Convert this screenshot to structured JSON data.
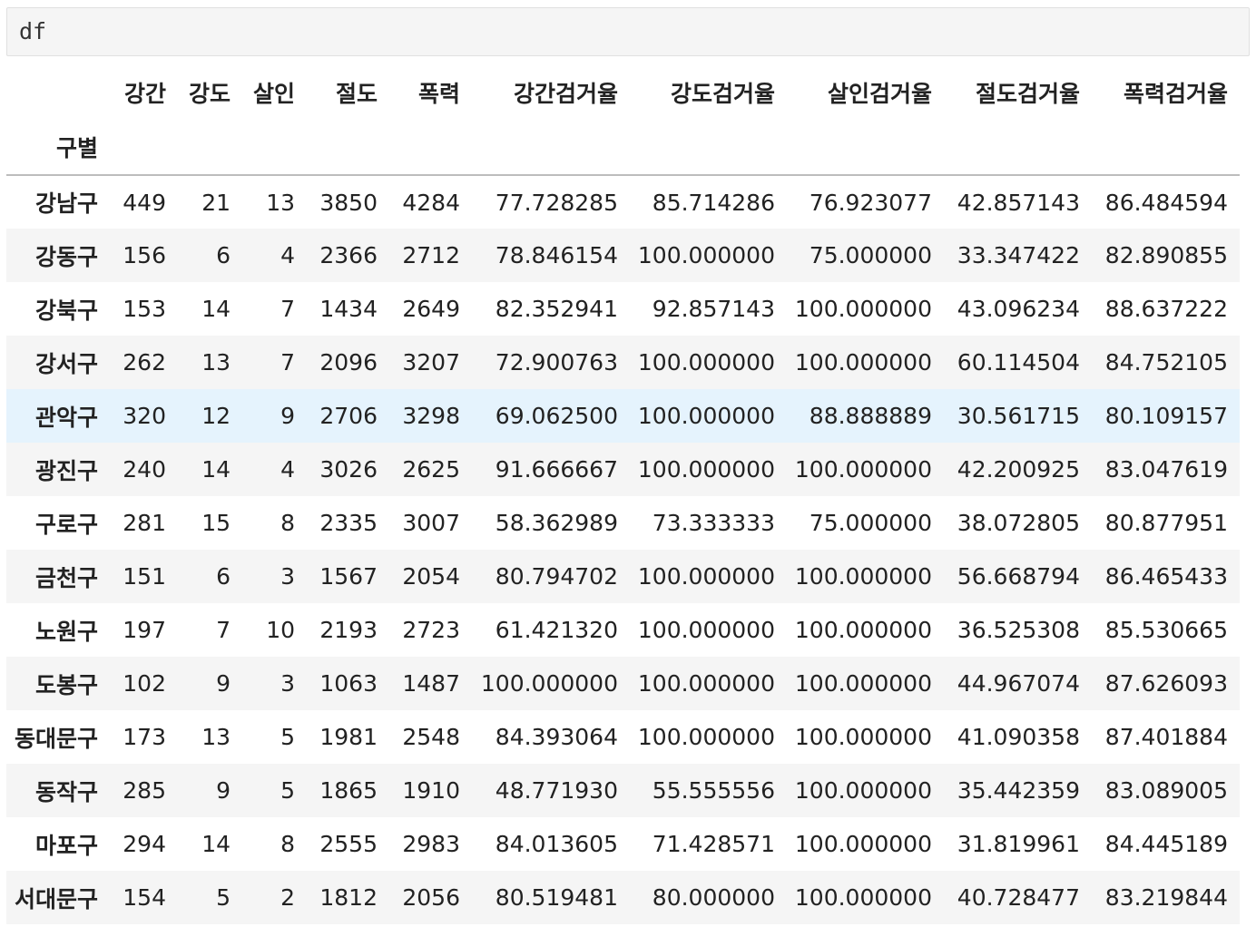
{
  "input_cell": {
    "code": "df"
  },
  "dataframe": {
    "index_name": "구별",
    "columns": [
      "강간",
      "강도",
      "살인",
      "절도",
      "폭력",
      "강간검거율",
      "강도검거율",
      "살인검거율",
      "절도검거율",
      "폭력검거율"
    ],
    "rows": [
      {
        "index": "강남구",
        "values": [
          "449",
          "21",
          "13",
          "3850",
          "4284",
          "77.728285",
          "85.714286",
          "76.923077",
          "42.857143",
          "86.484594"
        ]
      },
      {
        "index": "강동구",
        "values": [
          "156",
          "6",
          "4",
          "2366",
          "2712",
          "78.846154",
          "100.000000",
          "75.000000",
          "33.347422",
          "82.890855"
        ]
      },
      {
        "index": "강북구",
        "values": [
          "153",
          "14",
          "7",
          "1434",
          "2649",
          "82.352941",
          "92.857143",
          "100.000000",
          "43.096234",
          "88.637222"
        ]
      },
      {
        "index": "강서구",
        "values": [
          "262",
          "13",
          "7",
          "2096",
          "3207",
          "72.900763",
          "100.000000",
          "100.000000",
          "60.114504",
          "84.752105"
        ]
      },
      {
        "index": "관악구",
        "values": [
          "320",
          "12",
          "9",
          "2706",
          "3298",
          "69.062500",
          "100.000000",
          "88.888889",
          "30.561715",
          "80.109157"
        ]
      },
      {
        "index": "광진구",
        "values": [
          "240",
          "14",
          "4",
          "3026",
          "2625",
          "91.666667",
          "100.000000",
          "100.000000",
          "42.200925",
          "83.047619"
        ]
      },
      {
        "index": "구로구",
        "values": [
          "281",
          "15",
          "8",
          "2335",
          "3007",
          "58.362989",
          "73.333333",
          "75.000000",
          "38.072805",
          "80.877951"
        ]
      },
      {
        "index": "금천구",
        "values": [
          "151",
          "6",
          "3",
          "1567",
          "2054",
          "80.794702",
          "100.000000",
          "100.000000",
          "56.668794",
          "86.465433"
        ]
      },
      {
        "index": "노원구",
        "values": [
          "197",
          "7",
          "10",
          "2193",
          "2723",
          "61.421320",
          "100.000000",
          "100.000000",
          "36.525308",
          "85.530665"
        ]
      },
      {
        "index": "도봉구",
        "values": [
          "102",
          "9",
          "3",
          "1063",
          "1487",
          "100.000000",
          "100.000000",
          "100.000000",
          "44.967074",
          "87.626093"
        ]
      },
      {
        "index": "동대문구",
        "values": [
          "173",
          "13",
          "5",
          "1981",
          "2548",
          "84.393064",
          "100.000000",
          "100.000000",
          "41.090358",
          "87.401884"
        ]
      },
      {
        "index": "동작구",
        "values": [
          "285",
          "9",
          "5",
          "1865",
          "1910",
          "48.771930",
          "55.555556",
          "100.000000",
          "35.442359",
          "83.089005"
        ]
      },
      {
        "index": "마포구",
        "values": [
          "294",
          "14",
          "8",
          "2555",
          "2983",
          "84.013605",
          "71.428571",
          "100.000000",
          "31.819961",
          "84.445189"
        ]
      },
      {
        "index": "서대문구",
        "values": [
          "154",
          "5",
          "2",
          "1812",
          "2056",
          "80.519481",
          "80.000000",
          "100.000000",
          "40.728477",
          "83.219844"
        ]
      }
    ],
    "hovered_row_index": 4,
    "colors": {
      "input_background": "#f5f5f5",
      "striped_row": "#f5f5f5",
      "hovered_row": "#e5f3fd",
      "header_rule": "#bdbdbd"
    }
  }
}
